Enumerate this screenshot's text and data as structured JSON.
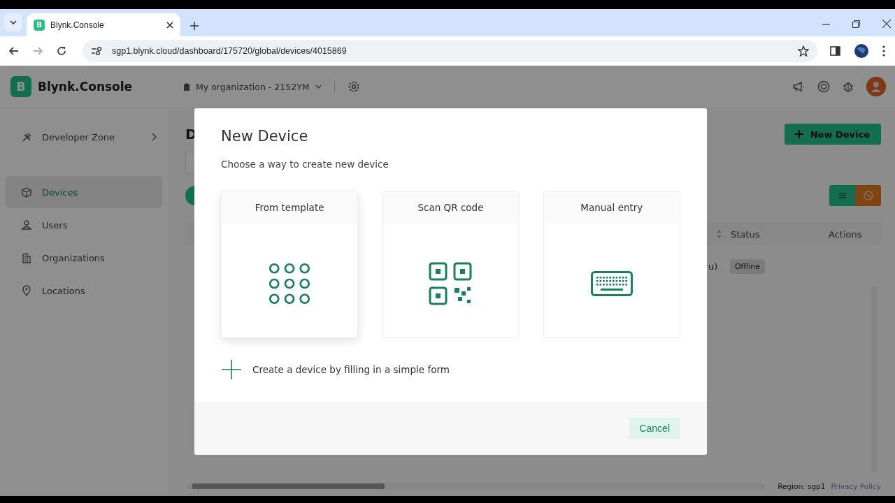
{
  "browser": {
    "tabs": [
      {
        "title": "Blynk.Console",
        "favicon": "B",
        "selected": true
      }
    ],
    "nav": [
      {
        "kind": "back",
        "disabled": false
      },
      {
        "kind": "forward",
        "disabled": true
      },
      {
        "kind": "reload",
        "disabled": false
      }
    ],
    "url": "sgp1.blynk.cloud/dashboard/175720/global/devices/4015869"
  },
  "app": {
    "logo": "B",
    "brand": "Blynk.Console",
    "organization": "My organization - 2152YM",
    "sidebar": {
      "items": [
        {
          "kind": "tools",
          "label": "Developer Zone",
          "has_submenu": true,
          "selected": false
        },
        {
          "kind": "box",
          "label": "Devices",
          "has_submenu": false,
          "selected": true
        },
        {
          "kind": "users",
          "label": "Users",
          "has_submenu": false,
          "selected": false
        },
        {
          "kind": "building",
          "label": "Organizations",
          "has_submenu": false,
          "selected": false
        },
        {
          "kind": "pin",
          "label": "Locations",
          "has_submenu": false,
          "selected": false
        }
      ]
    },
    "page_heading": "D",
    "new_device_button": "New Device",
    "table": {
      "columns": [
        "Status",
        "Actions"
      ],
      "rows": [
        {
          "column_1": "u)",
          "status": "Offline"
        }
      ]
    },
    "footer": {
      "region": "Region: sgp1",
      "privacy_link": "Privacy Policy"
    }
  },
  "dialog": {
    "title": "New Device",
    "subtitle": "Choose a way to create new device",
    "options": [
      {
        "kind": "template",
        "label": "From template",
        "hovered": true
      },
      {
        "kind": "qr",
        "label": "Scan QR code",
        "hovered": false
      },
      {
        "kind": "keyboard",
        "label": "Manual entry",
        "hovered": false
      }
    ],
    "form_link": "Create a device by filling in a simple form",
    "cancel": "Cancel"
  }
}
